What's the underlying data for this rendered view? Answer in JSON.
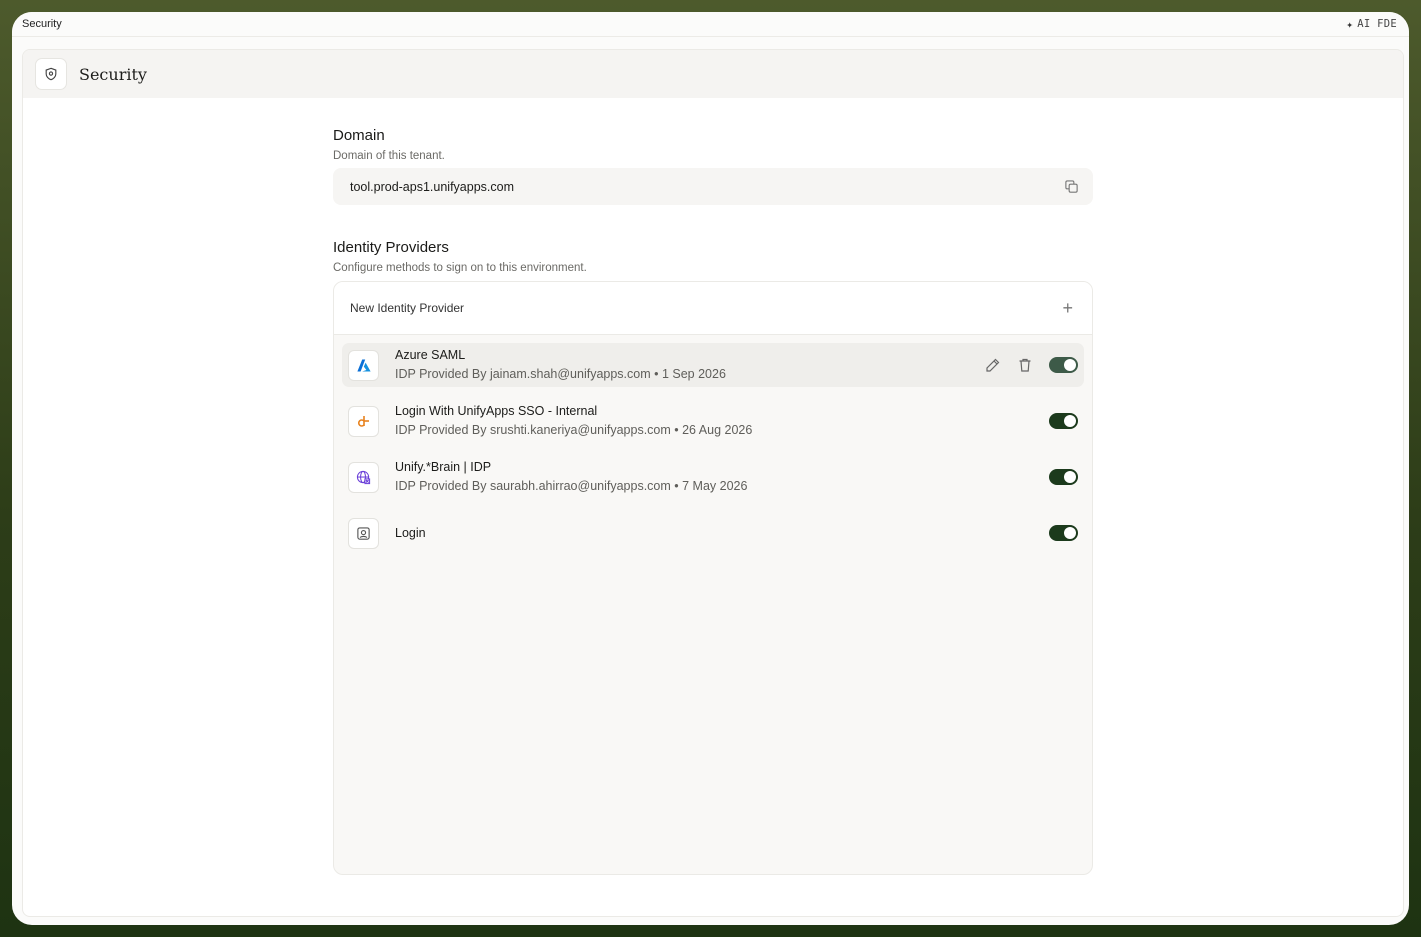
{
  "window": {
    "title": "Security",
    "ai_label": "AI FDE"
  },
  "header": {
    "title": "Security",
    "icon": "shield-icon"
  },
  "domain": {
    "title": "Domain",
    "subtitle": "Domain of this tenant.",
    "value": "tool.prod-aps1.unifyapps.com",
    "copy_icon": "copy-icon"
  },
  "identity_providers": {
    "title": "Identity Providers",
    "subtitle": "Configure methods to sign on to this environment.",
    "new_label": "New Identity Provider",
    "items": [
      {
        "name": "Azure SAML",
        "meta": "IDP Provided By jainam.shah@unifyapps.com • 1 Sep 2026",
        "icon": "azure-icon",
        "enabled": true,
        "selected": true
      },
      {
        "name": "Login With UnifyApps SSO - Internal",
        "meta": "IDP Provided By srushti.kaneriya@unifyapps.com • 26 Aug 2026",
        "icon": "unifyapps-icon",
        "enabled": true
      },
      {
        "name": "Unify.*Brain | IDP",
        "meta": "IDP Provided By saurabh.ahirrao@unifyapps.com • 7 May 2026",
        "icon": "globe-icon",
        "enabled": true
      },
      {
        "name": "Login",
        "icon": "user-card-icon",
        "enabled": true
      }
    ]
  },
  "colors": {
    "toggle_on": "#1c3a1c",
    "accent_azure": "#0a6fd6",
    "accent_unify": "#e8821e",
    "accent_brain": "#6a3fd8"
  }
}
